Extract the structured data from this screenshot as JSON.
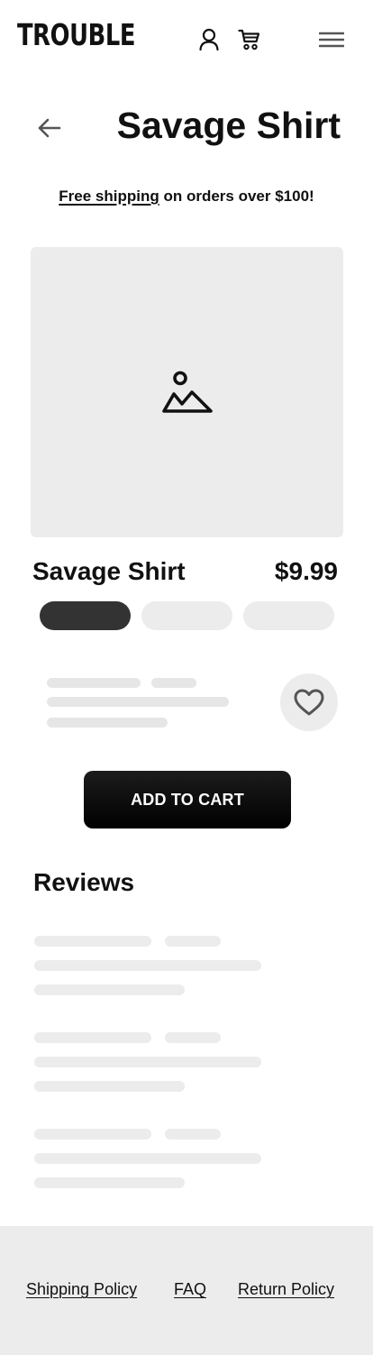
{
  "header": {
    "logo": "TROUBLE",
    "account_icon": "user-icon",
    "cart_icon": "cart-icon",
    "menu_icon": "hamburger-menu-icon"
  },
  "title_bar": {
    "back_icon": "arrow-left-icon",
    "title": "Savage Shirt"
  },
  "shipping_notice": {
    "link_text": "Free shipping",
    "rest_text": " on orders over $100!"
  },
  "product": {
    "image_icon": "image-placeholder-icon",
    "name": "Savage Shirt",
    "price": "$9.99",
    "variants_count": 3,
    "selected_variant_index": 0,
    "favorite_icon": "heart-icon"
  },
  "actions": {
    "add_to_cart_label": "ADD TO CART"
  },
  "reviews": {
    "title": "Reviews"
  },
  "footer": {
    "links": [
      "Shipping Policy",
      "FAQ",
      "Return Policy"
    ]
  },
  "colors": {
    "text": "#111111",
    "placeholder_gray": "#ececec",
    "selected_pill": "#333333",
    "button_bg": "#000000",
    "button_text": "#ffffff"
  }
}
